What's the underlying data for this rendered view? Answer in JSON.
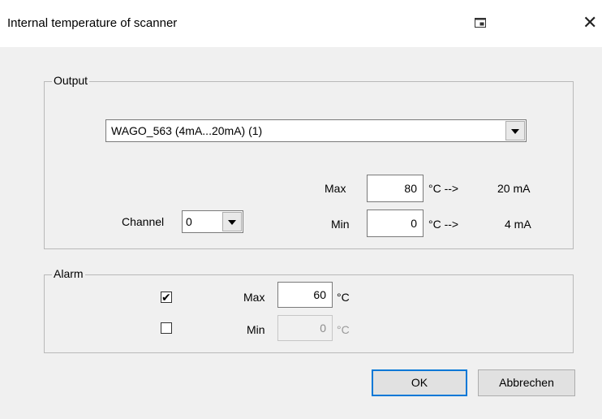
{
  "window": {
    "title": "Internal temperature of scanner",
    "close_glyph": "✕",
    "title_icon": "restore-window-icon"
  },
  "output": {
    "group_label": "Output",
    "device_select": "WAGO_563 (4mA...20mA) (1)",
    "channel_label": "Channel",
    "channel_value": "0",
    "max_label": "Max",
    "max_value": "80",
    "max_unit_arrow": "°C -->",
    "max_output": "20 mA",
    "min_label": "Min",
    "min_value": "0",
    "min_unit_arrow": "°C -->",
    "min_output": "4 mA"
  },
  "alarm": {
    "group_label": "Alarm",
    "max_checked": true,
    "max_label": "Max",
    "max_value": "60",
    "max_unit": "°C",
    "min_checked": false,
    "min_label": "Min",
    "min_value": "0",
    "min_unit": "°C"
  },
  "buttons": {
    "ok": "OK",
    "cancel": "Abbrechen"
  }
}
